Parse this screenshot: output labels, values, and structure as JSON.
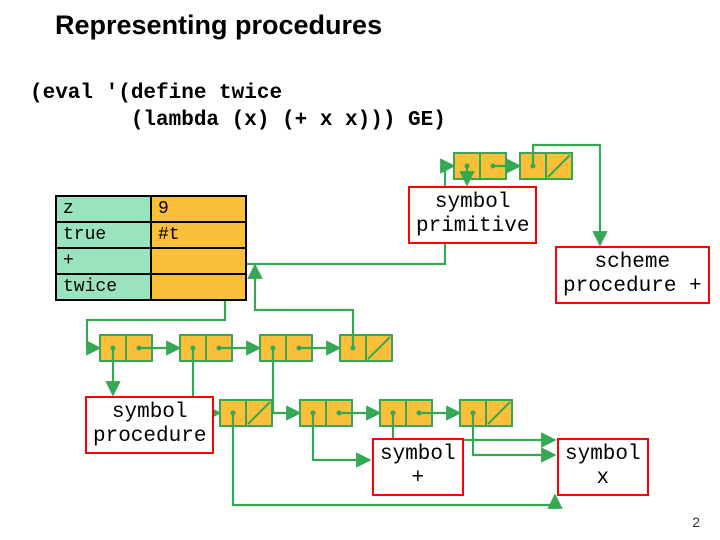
{
  "title": "Representing procedures",
  "code_line1": "(eval '(define twice",
  "code_line2": "        (lambda (x) (+ x x))) GE)",
  "env": {
    "rows": [
      {
        "k": "z",
        "v": "9"
      },
      {
        "k": "true",
        "v": "#t"
      },
      {
        "k": "+",
        "v": ""
      },
      {
        "k": "twice",
        "v": ""
      }
    ]
  },
  "tag_primitive_l1": "symbol",
  "tag_primitive_l2": "primitive",
  "tag_schemeproc_l1": "scheme",
  "tag_schemeproc_l2": "procedure +",
  "tag_procedure_l1": "symbol",
  "tag_procedure_l2": "procedure",
  "tag_plus_l1": "symbol",
  "tag_plus_l2": "+",
  "tag_x_l1": "symbol",
  "tag_x_l2": "x",
  "page_number": "2",
  "colors": {
    "green": "#34a853",
    "orange": "#fbbf3a",
    "mint": "#9ae3bf",
    "red": "#ff0000"
  }
}
